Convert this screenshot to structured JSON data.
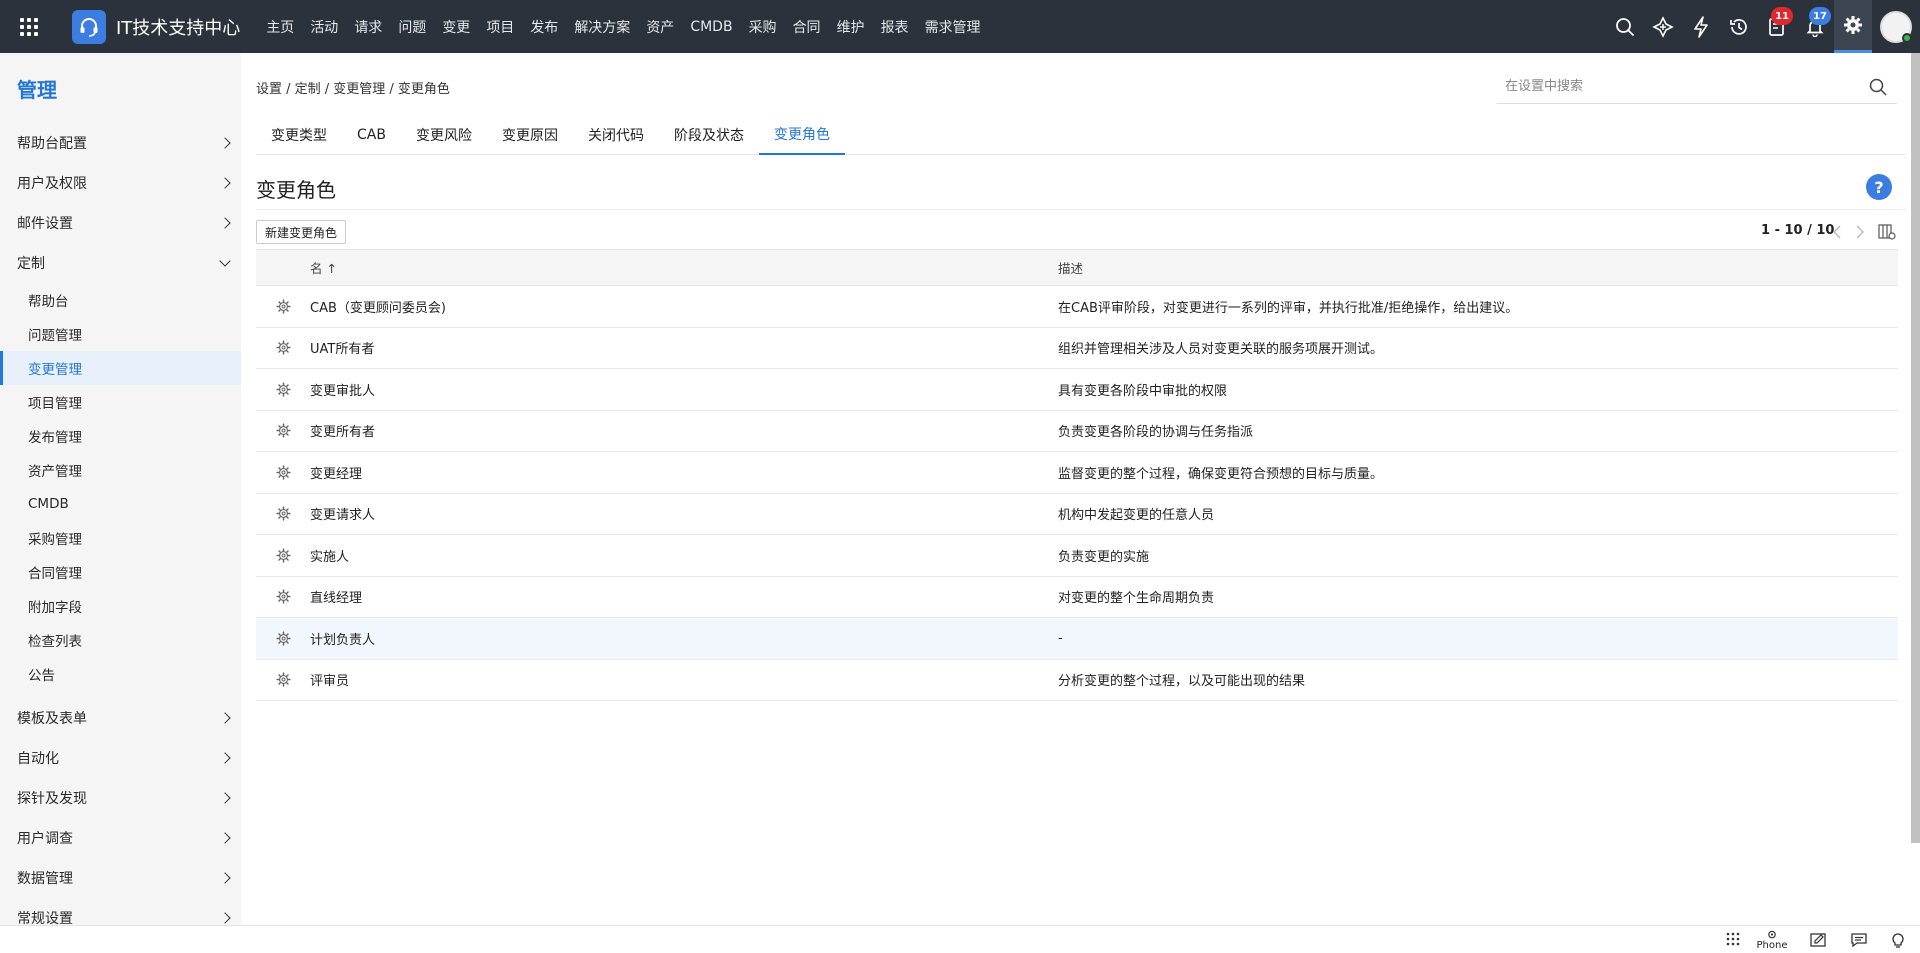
{
  "topbar": {
    "app_title": "IT技术支持中心",
    "nav": [
      "主页",
      "活动",
      "请求",
      "问题",
      "变更",
      "项目",
      "发布",
      "解决方案",
      "资产",
      "CMDB",
      "采购",
      "合同",
      "维护",
      "报表",
      "需求管理"
    ],
    "badges": {
      "tasks": "11",
      "notifications": "17"
    },
    "colors": {
      "bar": "#2b323b",
      "accent": "#3b7de0",
      "badge_red": "#e0282e"
    }
  },
  "sidebar": {
    "title": "管理",
    "sections_top": [
      "帮助台配置",
      "用户及权限",
      "邮件设置"
    ],
    "open_section": "定制",
    "sub_items": [
      "帮助台",
      "问题管理",
      "变更管理",
      "项目管理",
      "发布管理",
      "资产管理",
      "CMDB",
      "采购管理",
      "合同管理",
      "附加字段",
      "检查列表",
      "公告"
    ],
    "active_sub": "变更管理",
    "sections_bottom": [
      "模板及表单",
      "自动化",
      "探针及发现",
      "用户调查",
      "数据管理",
      "常规设置"
    ]
  },
  "main": {
    "breadcrumb": "设置 / 定制 / 变更管理 / 变更角色",
    "search_placeholder": "在设置中搜索",
    "tabs": [
      "变更类型",
      "CAB",
      "变更风险",
      "变更原因",
      "关闭代码",
      "阶段及状态",
      "变更角色"
    ],
    "active_tab": "变更角色",
    "page_title": "变更角色",
    "help_label": "?",
    "new_button": "新建变更角色",
    "pager": "1 - 10 / 10",
    "columns": {
      "name": "名 ↑",
      "desc": "描述"
    },
    "rows": [
      {
        "name": "CAB（变更顾问委员会)",
        "desc": "在CAB评审阶段，对变更进行一系列的评审，并执行批准/拒绝操作，给出建议。"
      },
      {
        "name": "UAT所有者",
        "desc": "组织并管理相关涉及人员对变更关联的服务项展开测试。"
      },
      {
        "name": "变更审批人",
        "desc": "具有变更各阶段中审批的权限"
      },
      {
        "name": "变更所有者",
        "desc": "负责变更各阶段的协调与任务指派"
      },
      {
        "name": "变更经理",
        "desc": "监督变更的整个过程，确保变更符合预想的目标与质量。"
      },
      {
        "name": "变更请求人",
        "desc": "机构中发起变更的任意人员"
      },
      {
        "name": "实施人",
        "desc": "负责变更的实施"
      },
      {
        "name": "直线经理",
        "desc": "对变更的整个生命周期负责"
      },
      {
        "name": "计划负责人",
        "desc": "-"
      },
      {
        "name": "评审员",
        "desc": "分析变更的整个过程，以及可能出现的结果"
      }
    ]
  },
  "bottombar": {
    "phone_label": "Phone"
  }
}
